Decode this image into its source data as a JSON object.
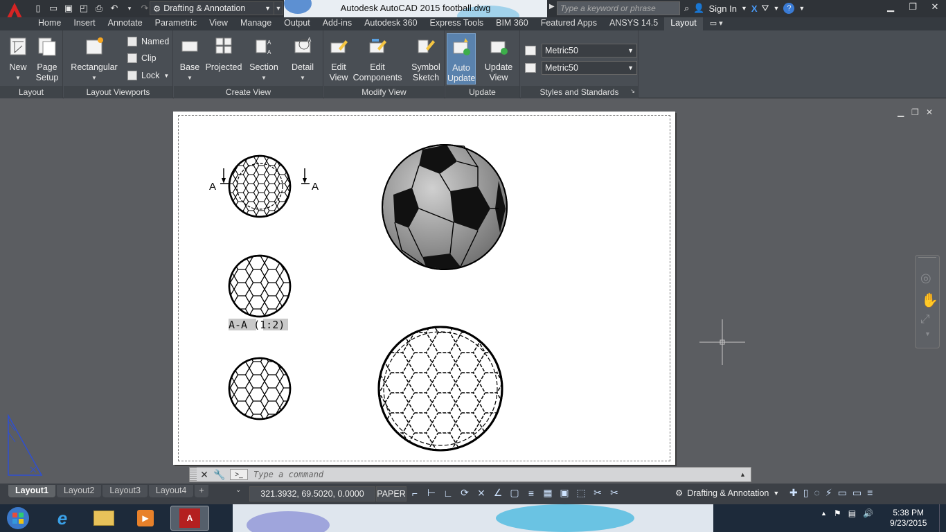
{
  "window": {
    "title": "Autodesk AutoCAD 2015    football.dwg",
    "workspace": "Drafting & Annotation",
    "search_placeholder": "Type a keyword or phrase",
    "sign_in": "Sign In"
  },
  "tabs": [
    {
      "label": "Home"
    },
    {
      "label": "Insert"
    },
    {
      "label": "Annotate"
    },
    {
      "label": "Parametric"
    },
    {
      "label": "View"
    },
    {
      "label": "Manage"
    },
    {
      "label": "Output"
    },
    {
      "label": "Add-ins"
    },
    {
      "label": "Autodesk 360"
    },
    {
      "label": "Express Tools"
    },
    {
      "label": "BIM 360"
    },
    {
      "label": "Featured Apps"
    },
    {
      "label": "ANSYS 14.5"
    },
    {
      "label": "Layout"
    }
  ],
  "ribbon": {
    "layout_panel": {
      "title": "Layout",
      "new": "New",
      "page_setup_1": "Page",
      "page_setup_2": "Setup"
    },
    "viewports_panel": {
      "title": "Layout Viewports",
      "rectangular": "Rectangular",
      "named": "Named",
      "clip": "Clip",
      "lock": "Lock"
    },
    "create_view_panel": {
      "title": "Create View",
      "base": "Base",
      "projected": "Projected",
      "section": "Section",
      "detail": "Detail"
    },
    "modify_view_panel": {
      "title": "Modify View",
      "edit_view_1": "Edit",
      "edit_view_2": "View",
      "edit_comp_1": "Edit",
      "edit_comp_2": "Components",
      "symbol_1": "Symbol",
      "symbol_2": "Sketch"
    },
    "update_panel": {
      "title": "Update",
      "auto_1": "Auto",
      "auto_2": "Update",
      "upd_1": "Update",
      "upd_2": "View"
    },
    "styles_panel": {
      "title": "Styles and Standards",
      "style1": "Metric50",
      "style2": "Metric50"
    }
  },
  "drawing": {
    "section_label_left": "A",
    "section_label_right": "A",
    "section_caption": "A-A (1:2)"
  },
  "command": {
    "placeholder": "Type a command"
  },
  "status": {
    "layout_tabs": [
      "Layout1",
      "Layout2",
      "Layout3",
      "Layout4"
    ],
    "coordinates": "321.3932, 69.5020, 0.0000",
    "space": "PAPER",
    "workspace": "Drafting & Annotation"
  },
  "taskbar": {
    "time": "5:38 PM",
    "date": "9/23/2015"
  }
}
